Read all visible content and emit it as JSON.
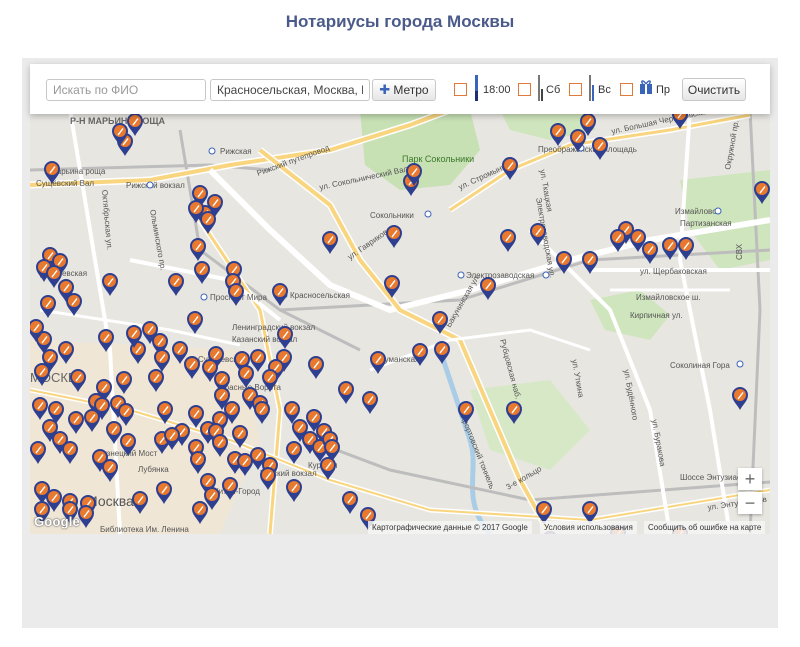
{
  "page": {
    "title": "Нотариусы города Москвы"
  },
  "filters": {
    "name_placeholder": "Искать по ФИО",
    "address_value": "Красносельская, Москва, Рос",
    "metro_label": "Метро",
    "checkboxes": [
      {
        "label": "18:00",
        "icon": "clock-hours-icon",
        "checked": false
      },
      {
        "label": "Сб",
        "icon": "saturday-icon",
        "checked": false
      },
      {
        "label": "Вс",
        "icon": "sunday-icon",
        "checked": false
      },
      {
        "label": "Пр",
        "icon": "holiday-gift-icon",
        "checked": false
      }
    ],
    "clear_label": "Очистить"
  },
  "map": {
    "labels": [
      "Р-Н МАРЬИНА РОЩА",
      "Марьина роща",
      "Сущёвский Вал",
      "Рижский вокзал",
      "Рижская",
      "Рижский путепровод",
      "Парк Сокольники",
      "Сокольники",
      "ул. Сокольнический Вал",
      "ул. Стромынка",
      "Преображенская площадь",
      "ул. Большая Черкизовская",
      "Измайлово",
      "Партизанская",
      "Проспект Мира",
      "Красносельская",
      "Достоевская",
      "Ленинградский вокзал",
      "Казанский вокзал",
      "Сухаревская",
      "Красные Ворота",
      "Бауманская",
      "Электрозаводская",
      "ул. Щербаковская",
      "Лефортовский тоннель",
      "Рубцовская наб.",
      "Бакунинская ул.",
      "Измайловское ш.",
      "Кирпичная ул.",
      "Соколиная Гора",
      "Шоссе Энтузиастов",
      "Курский вокзал",
      "Курская",
      "Лубянка",
      "Кузнецкий Мост",
      "Китай-Город",
      "Библиотека Им. Ленина",
      "Москва",
      "МОСКВА",
      "3-е кольцо",
      "Окружной пр.",
      "СВХ",
      "ул. Буракова",
      "ул. Будённого",
      "ул. Уткина",
      "ул. Энтузиастов",
      "Электрозаводская ул.",
      "ул. Гаврикова",
      "ул. Ткацкая",
      "Ольминского пр.",
      "Октябрьская ул."
    ],
    "footer": {
      "data_credit": "Картографические данные © 2017 Google",
      "terms": "Условия использования",
      "report": "Сообщить об ошибке на карте"
    },
    "google_logo": "Google",
    "zoom_in": "+",
    "zoom_out": "−",
    "marker_color": "#e8792e",
    "marker_border": "#2f3f8f"
  }
}
